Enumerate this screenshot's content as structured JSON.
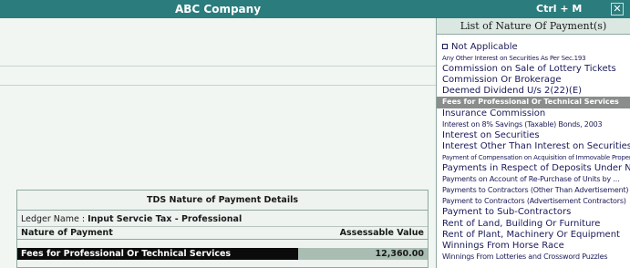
{
  "header": {
    "company_name": "ABC Company",
    "shortcut": "Ctrl + M",
    "close_glyph": "✕"
  },
  "list_panel": {
    "title": "List of Nature Of Payment(s)",
    "selected_index": 6,
    "items": [
      "Not Applicable",
      "Any Other Interest on Securities As Per Sec.193",
      "Commission on Sale of Lottery Tickets",
      "Commission Or Brokerage",
      "Deemed Dividend U/s 2(22)(E)",
      "Fees for Professional Or Technical Services",
      "Insurance Commission",
      "Interest on 8% Savings (Taxable) Bonds, 2003",
      "Interest on Securities",
      "Interest Other Than Interest on Securities",
      "Payment of Compensation on Acquisition of Immovable Property",
      "Payments in Respect of Deposits Under NSS",
      "Payments on Account of Re-Purchase of Units by ...",
      "Payments to Contractors (Other Than Advertisement)",
      "Payment to Contractors (Advertisement Contractors)",
      "Payment to Sub-Contractors",
      "Rent of Land, Building Or Furniture",
      "Rent of Plant, Machinery Or Equipment",
      "Winnings From Horse Race",
      "Winnings From Lotteries and Crossword Puzzles"
    ]
  },
  "tds_details": {
    "title": "TDS Nature of Payment Details",
    "ledger_label": "Ledger Name :",
    "ledger_name": "Input Servcie Tax - Professional",
    "col_nature": "Nature of Payment",
    "col_value": "Assessable Value",
    "row_nature": "Fees for Professional Or Technical Services",
    "row_value": "12,360.00"
  },
  "colors": {
    "title_bar": "#2b7c7c",
    "selection": "#8a8d8c",
    "row_highlight": "#0b0b0b"
  }
}
